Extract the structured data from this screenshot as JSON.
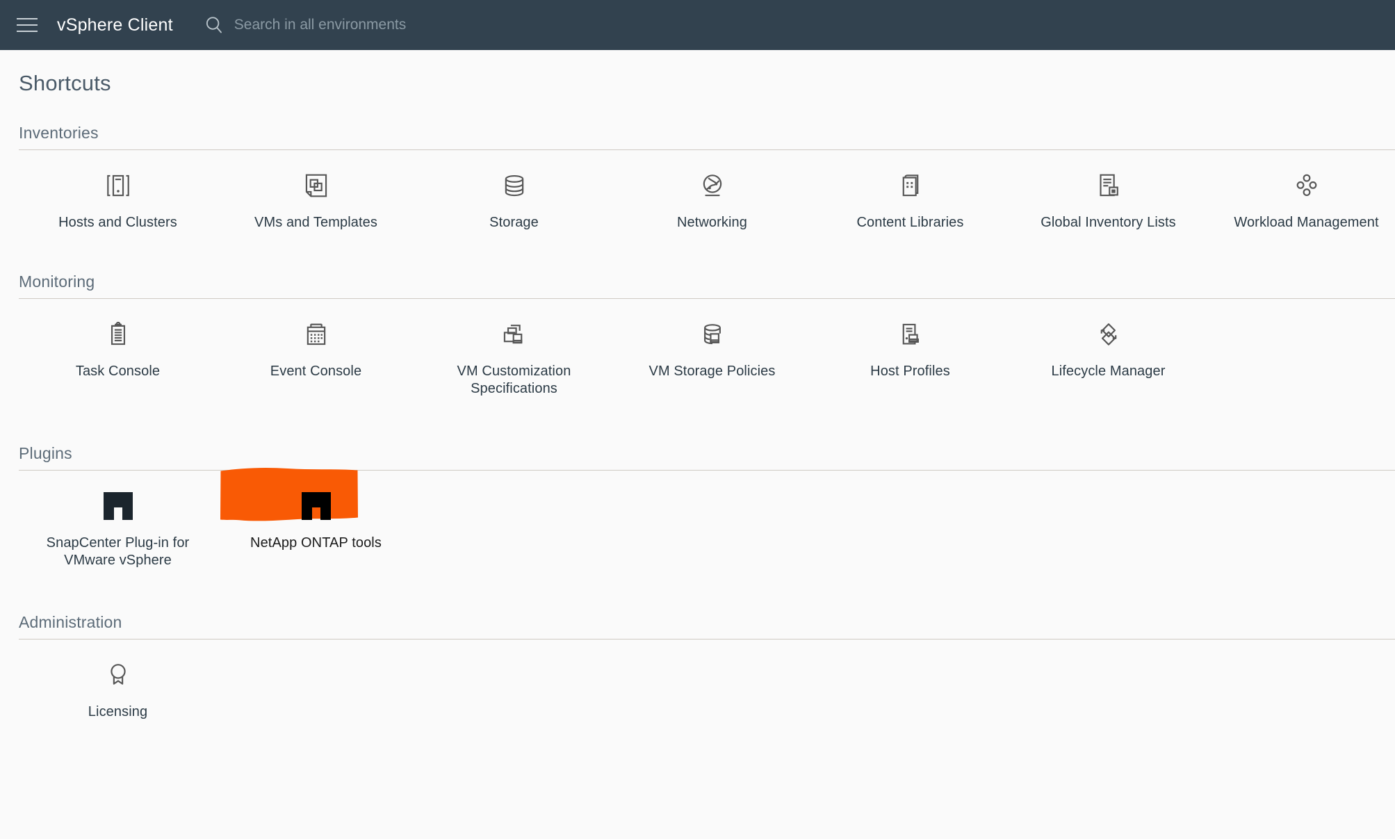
{
  "header": {
    "menu_icon": "hamburger-menu-icon",
    "app_title": "vSphere Client",
    "search_icon": "search-icon",
    "search_placeholder": "Search in all environments",
    "search_value": "",
    "background_color": "#32424f"
  },
  "page": {
    "title": "Shortcuts",
    "background_color": "#fafafa"
  },
  "highlight": {
    "color": "#f95a05",
    "target_label": "NetApp ONTAP tools"
  },
  "sections": [
    {
      "id": "inventories",
      "title": "Inventories",
      "items": [
        {
          "label": "Hosts and Clusters",
          "icon": "hosts-and-clusters-icon"
        },
        {
          "label": "VMs and Templates",
          "icon": "vms-and-templates-icon"
        },
        {
          "label": "Storage",
          "icon": "storage-database-icon"
        },
        {
          "label": "Networking",
          "icon": "networking-globe-icon"
        },
        {
          "label": "Content Libraries",
          "icon": "content-libraries-book-icon"
        },
        {
          "label": "Global Inventory Lists",
          "icon": "global-inventory-lists-icon"
        },
        {
          "label": "Workload Management",
          "icon": "workload-management-icon"
        }
      ]
    },
    {
      "id": "monitoring",
      "title": "Monitoring",
      "items": [
        {
          "label": "Task Console",
          "icon": "task-console-clipboard-icon"
        },
        {
          "label": "Event Console",
          "icon": "event-console-calendar-icon"
        },
        {
          "label": "VM Customization Specifications",
          "icon": "vm-customization-specifications-icon"
        },
        {
          "label": "VM Storage Policies",
          "icon": "vm-storage-policies-icon"
        },
        {
          "label": "Host Profiles",
          "icon": "host-profiles-icon"
        },
        {
          "label": "Lifecycle Manager",
          "icon": "lifecycle-manager-refresh-icon"
        }
      ]
    },
    {
      "id": "plugins",
      "title": "Plugins",
      "items": [
        {
          "label": "SnapCenter Plug-in for VMware vSphere",
          "icon": "netapp-logo-icon",
          "highlighted": false
        },
        {
          "label": "NetApp ONTAP tools",
          "icon": "netapp-logo-icon",
          "highlighted": true
        }
      ]
    },
    {
      "id": "administration",
      "title": "Administration",
      "items": [
        {
          "label": "Licensing",
          "icon": "licensing-award-icon"
        }
      ]
    }
  ]
}
